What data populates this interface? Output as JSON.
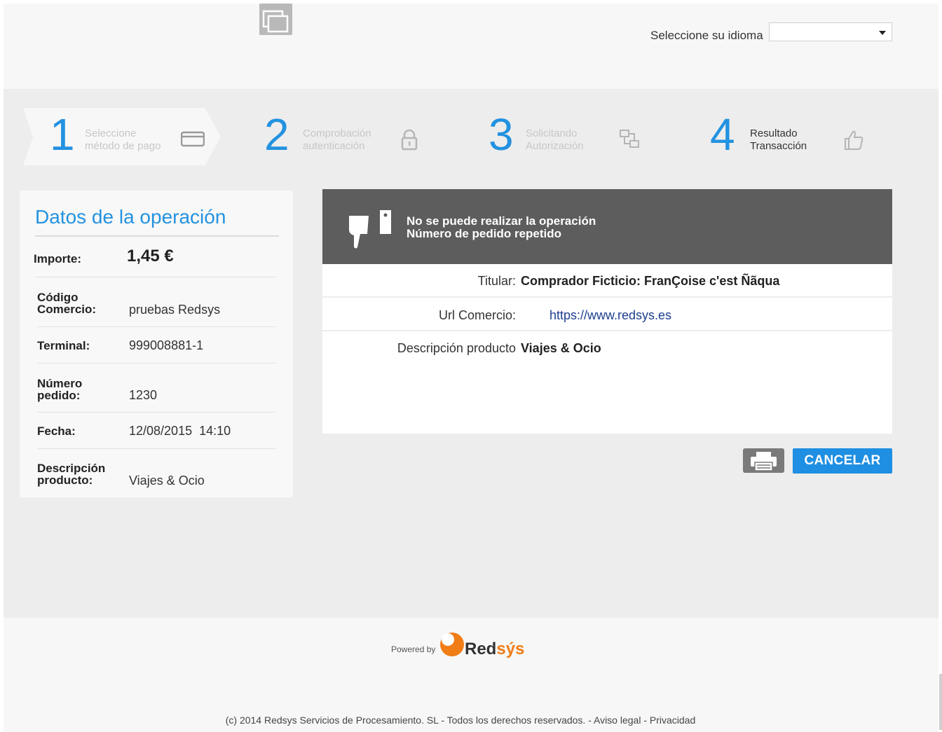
{
  "header": {
    "language_label": "Seleccione su idioma",
    "language_value": ""
  },
  "steps": [
    {
      "number": "1",
      "label_line1": "Seleccione",
      "label_line2": "método de pago",
      "icon": "card-icon"
    },
    {
      "number": "2",
      "label_line1": "Comprobación",
      "label_line2": "autenticación",
      "icon": "lock-icon"
    },
    {
      "number": "3",
      "label_line1": "Solicitando",
      "label_line2": "Autorización",
      "icon": "transfer-icon"
    },
    {
      "number": "4",
      "label_line1": "Resultado",
      "label_line2": "Transacción",
      "icon": "thumbs-up-icon"
    }
  ],
  "operation": {
    "title": "Datos de la operación",
    "rows": [
      {
        "key_line1": "Importe:",
        "key_line2": "",
        "value": "1,45 €"
      },
      {
        "key_line1": "Código",
        "key_line2": "Comercio:",
        "value": "pruebas Redsys"
      },
      {
        "key_line1": "Terminal:",
        "key_line2": "",
        "value": "999008881-1"
      },
      {
        "key_line1": "Número",
        "key_line2": "pedido:",
        "value": "1230"
      },
      {
        "key_line1": "Fecha:",
        "key_line2": "",
        "value": "12/08/2015  14:10"
      },
      {
        "key_line1": "Descripción",
        "key_line2": "producto:",
        "value": "Viajes & Ocio"
      }
    ]
  },
  "result": {
    "message_line1": "No se puede realizar la operación",
    "message_line2": "Número de pedido repetido",
    "titular_label": "Titular:",
    "titular_value": "Comprador Ficticio: FranÇoise c'est Ñãqua",
    "url_label": "Url Comercio:",
    "url_value": "https://www.redsys.es",
    "desc_label": "Descripción producto",
    "desc_value": "Viajes & Ocio"
  },
  "actions": {
    "cancel_label": "CANCELAR"
  },
  "footer": {
    "powered_by": "Powered by",
    "brand_main": "Red",
    "brand_accent": "sýs",
    "copyright": "(c) 2014 Redsys Servicios de Procesamiento. SL - Todos los derechos reservados. - Aviso legal - Privacidad"
  },
  "colors": {
    "accent_blue": "#2392e0",
    "banner_gray": "#5d5d5d",
    "brand_orange": "#f07d16"
  }
}
